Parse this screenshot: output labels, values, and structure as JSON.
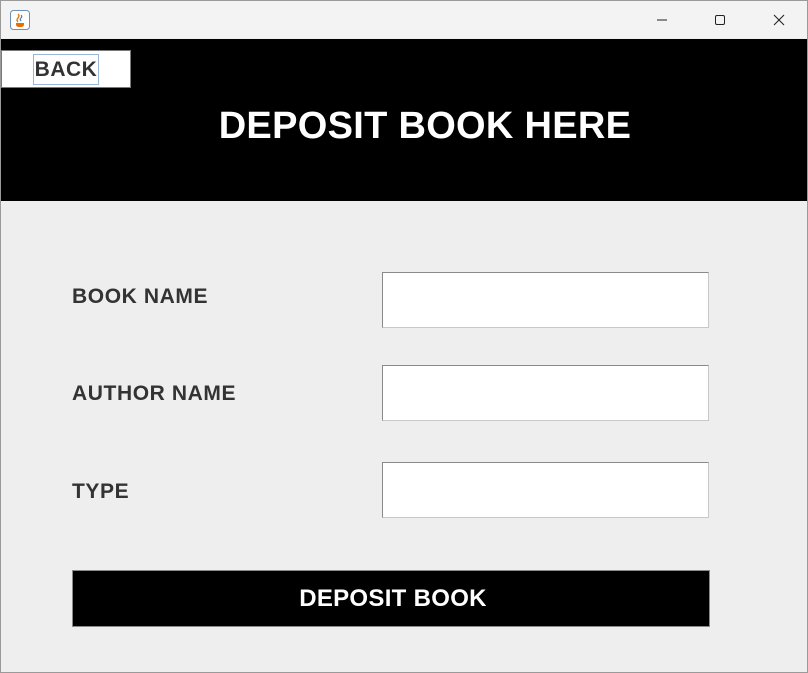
{
  "window": {
    "controls": {
      "minimize_icon": "minimize-icon",
      "maximize_icon": "maximize-icon",
      "close_icon": "close-icon"
    },
    "app_icon": "java-cup-icon"
  },
  "header": {
    "back_label": "BACK",
    "title": "DEPOSIT BOOK HERE"
  },
  "form": {
    "book_name_label": "BOOK NAME",
    "book_name_value": "",
    "author_name_label": "AUTHOR NAME",
    "author_name_value": "",
    "type_label": "TYPE",
    "type_value": "",
    "submit_label": "DEPOSIT BOOK"
  },
  "colors": {
    "header_bg": "#000000",
    "page_bg": "#EEEEEE",
    "label_text": "#333333",
    "button_bg": "#000000",
    "button_text": "#FFFFFF"
  }
}
